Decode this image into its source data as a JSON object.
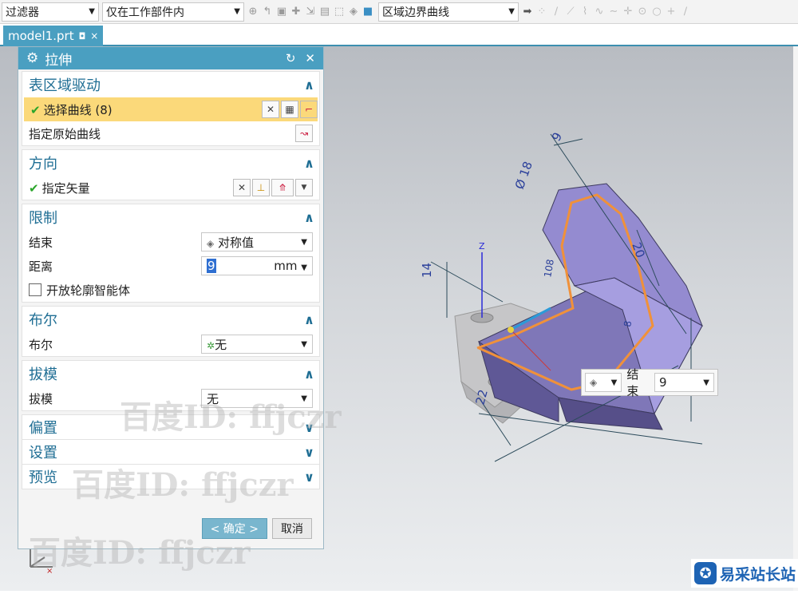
{
  "toolbar": {
    "filter_label": "过滤器",
    "scope_label": "仅在工作部件内",
    "curve_rule_label": "区域边界曲线"
  },
  "tab": {
    "filename": "model1.prt",
    "pin_icon": "pin-icon",
    "close_icon": "close-icon"
  },
  "dialog": {
    "title": "拉伸",
    "sections": {
      "drive": {
        "title": "表区域驱动",
        "select_curve": "选择曲线 (8)",
        "orig_curve": "指定原始曲线"
      },
      "direction": {
        "title": "方向",
        "vector": "指定矢量"
      },
      "limits": {
        "title": "限制",
        "end_label": "结束",
        "end_value": "对称值",
        "distance_label": "距离",
        "distance_value": "9",
        "distance_unit": "mm",
        "open_profile": "开放轮廓智能体"
      },
      "boolean": {
        "title": "布尔",
        "label": "布尔",
        "value": "无"
      },
      "draft": {
        "title": "拔模",
        "label": "拔模",
        "value": "无"
      },
      "offset": {
        "title": "偏置"
      },
      "settings": {
        "title": "设置"
      },
      "preview": {
        "title": "预览"
      }
    },
    "ok_label": "< 确定 >",
    "cancel_label": "取消"
  },
  "float_toolbar": {
    "label": "结束",
    "value": "9"
  },
  "dims": {
    "d1": "9",
    "d2": "Ø 18",
    "d3": "20",
    "d4": "14",
    "d5": "108",
    "d6": "8",
    "d7": "22"
  },
  "watermark": {
    "text": "百度ID: ffjczr"
  },
  "logo": {
    "name": "易采站长站"
  },
  "colors": {
    "accent": "#4a9fc1",
    "selected": "#fbd97a",
    "model": "#8b80c4",
    "profile": "#f0913a"
  }
}
